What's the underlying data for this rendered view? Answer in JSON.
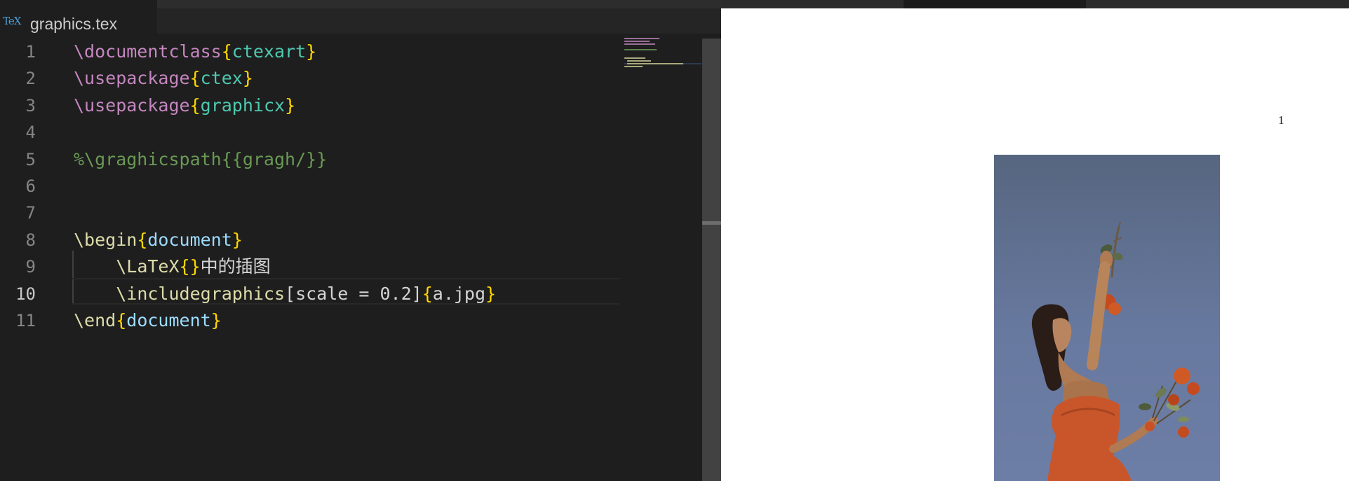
{
  "tab": {
    "icon": "TeX",
    "label": "graphics.tex"
  },
  "code": {
    "lines": [
      {
        "n": "1",
        "parts": [
          {
            "t": "\\documentclass",
            "c": "kw"
          },
          {
            "t": "{",
            "c": "br"
          },
          {
            "t": "ctexart",
            "c": "arg"
          },
          {
            "t": "}",
            "c": "br"
          }
        ]
      },
      {
        "n": "2",
        "parts": [
          {
            "t": "\\usepackage",
            "c": "kw"
          },
          {
            "t": "{",
            "c": "br"
          },
          {
            "t": "ctex",
            "c": "arg"
          },
          {
            "t": "}",
            "c": "br"
          }
        ]
      },
      {
        "n": "3",
        "parts": [
          {
            "t": "\\usepackage",
            "c": "kw"
          },
          {
            "t": "{",
            "c": "br"
          },
          {
            "t": "graphicx",
            "c": "arg"
          },
          {
            "t": "}",
            "c": "br"
          }
        ]
      },
      {
        "n": "4",
        "parts": []
      },
      {
        "n": "5",
        "parts": [
          {
            "t": "%\\graghicspath{{gragh/}}",
            "c": "cm"
          }
        ]
      },
      {
        "n": "6",
        "parts": []
      },
      {
        "n": "7",
        "parts": []
      },
      {
        "n": "8",
        "parts": [
          {
            "t": "\\begin",
            "c": "kw2"
          },
          {
            "t": "{",
            "c": "br"
          },
          {
            "t": "document",
            "c": "arg2"
          },
          {
            "t": "}",
            "c": "br"
          }
        ]
      },
      {
        "n": "9",
        "parts": [
          {
            "t": "    ",
            "c": "txt"
          },
          {
            "t": "\\LaTeX",
            "c": "kw2"
          },
          {
            "t": "{}",
            "c": "br"
          },
          {
            "t": "中的插图",
            "c": "txt"
          }
        ]
      },
      {
        "n": "10",
        "active": true,
        "parts": [
          {
            "t": "    ",
            "c": "txt"
          },
          {
            "t": "\\includegraphics",
            "c": "kw2"
          },
          {
            "t": "[scale = 0.2]",
            "c": "txt"
          },
          {
            "t": "{",
            "c": "br"
          },
          {
            "t": "a.jpg",
            "c": "txt"
          },
          {
            "t": "}",
            "c": "br"
          }
        ]
      },
      {
        "n": "11",
        "parts": [
          {
            "t": "\\end",
            "c": "kw2"
          },
          {
            "t": "{",
            "c": "br"
          },
          {
            "t": "document",
            "c": "arg2"
          },
          {
            "t": "}",
            "c": "br"
          }
        ]
      }
    ]
  },
  "viewer": {
    "page_number": "1"
  },
  "colors": {
    "editor_bg": "#1e1e1e",
    "keyword": "#c586c0",
    "command": "#dcdcaa",
    "argument": "#4ec9b0",
    "argument2": "#9cdcfe",
    "bracket": "#ffd700",
    "comment": "#6a9955",
    "sky": "#5f6f94",
    "dress": "#c8562a"
  }
}
